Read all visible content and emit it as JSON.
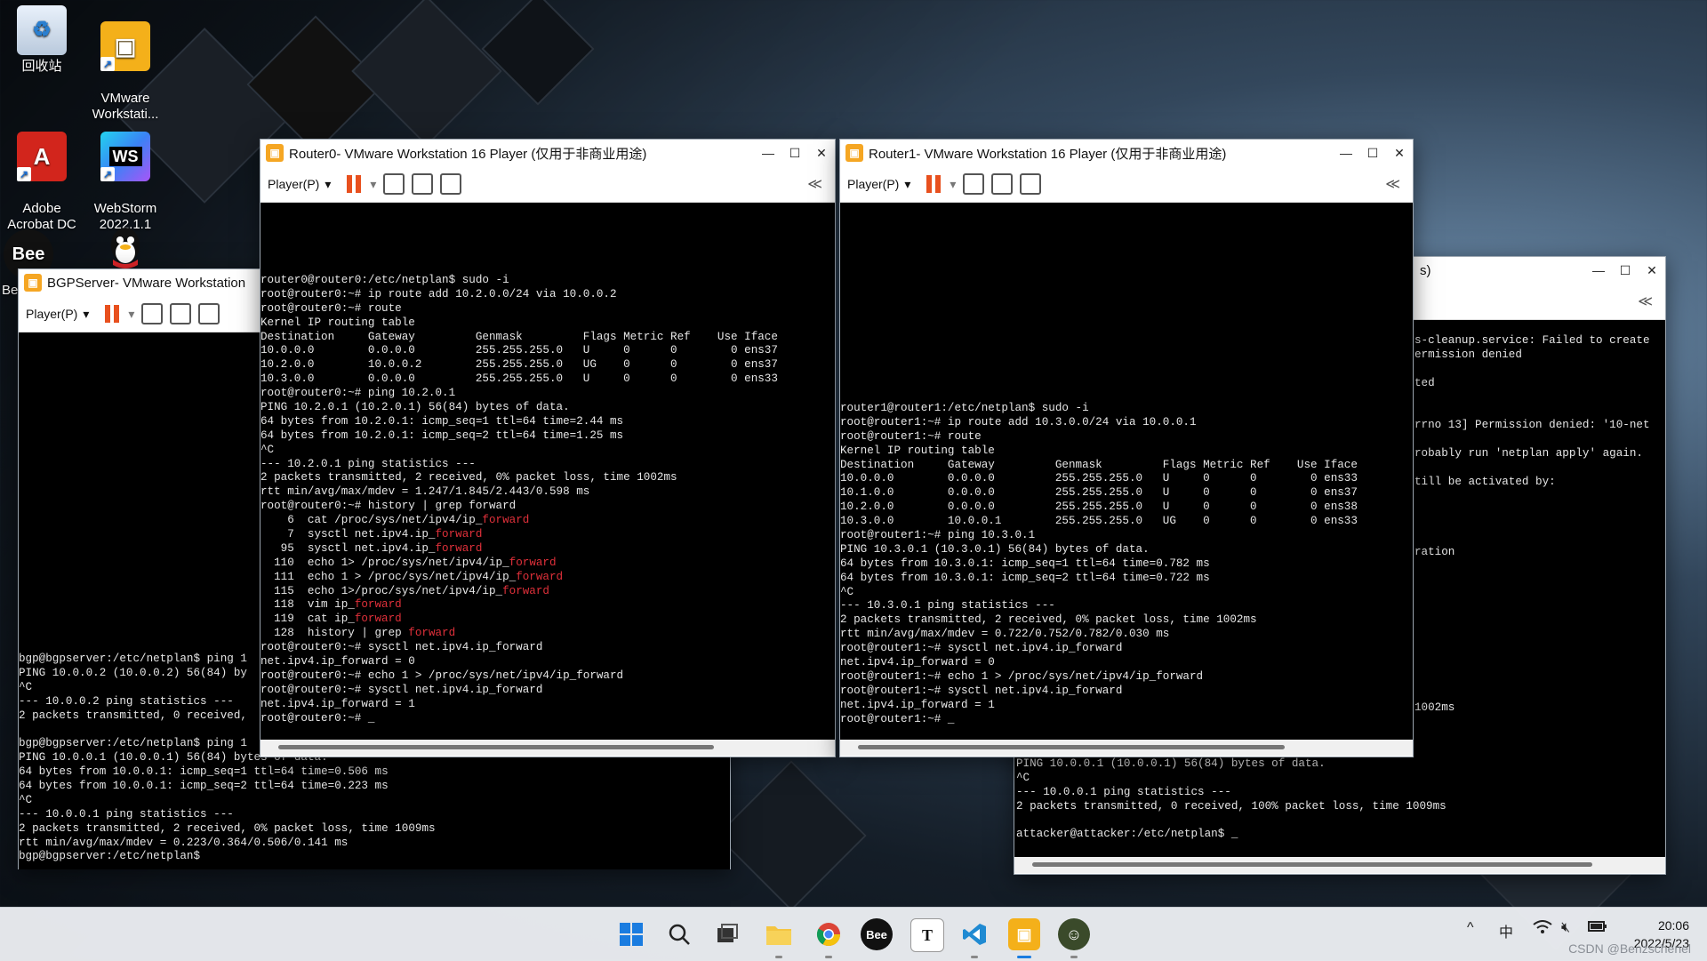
{
  "desktop_icons": [
    {
      "label": "回收站",
      "icon": "recycle-bin-icon"
    },
    {
      "label": "VMware\nWorkstati...",
      "icon": "vmware-icon"
    },
    {
      "label": "Adobe\nAcrobat DC",
      "icon": "acrobat-icon"
    },
    {
      "label": "WebStorm\n2022.1.1",
      "icon": "webstorm-icon"
    },
    {
      "label": "Be",
      "icon": "bee-icon"
    },
    {
      "label": "",
      "icon": "qq-icon"
    }
  ],
  "windows": {
    "bgp": {
      "title": "BGPServer- VMware Workstation",
      "player_label": "Player(P)",
      "lines": [
        "bgp@bgpserver:/etc/netplan$ ping 1",
        "PING 10.0.0.2 (10.0.0.2) 56(84) by",
        "^C",
        "--- 10.0.0.2 ping statistics ---",
        "2 packets transmitted, 0 received,",
        "",
        "bgp@bgpserver:/etc/netplan$ ping 1",
        "PING 10.0.0.1 (10.0.0.1) 56(84) bytes of data.",
        "64 bytes from 10.0.0.1: icmp_seq=1 ttl=64 time=0.506 ms",
        "64 bytes from 10.0.0.1: icmp_seq=2 ttl=64 time=0.223 ms",
        "^C",
        "--- 10.0.0.1 ping statistics ---",
        "2 packets transmitted, 2 received, 0% packet loss, time 1009ms",
        "rtt min/avg/max/mdev = 0.223/0.364/0.506/0.141 ms",
        "bgp@bgpserver:/etc/netplan$"
      ],
      "side_glyph": "In"
    },
    "router0": {
      "title": "Router0- VMware Workstation 16 Player (仅用于非商业用途)",
      "player_label": "Player(P)",
      "lines": [
        "router0@router0:/etc/netplan$ sudo -i",
        "root@router0:~# ip route add 10.2.0.0/24 via 10.0.0.2",
        "root@router0:~# route",
        "Kernel IP routing table",
        "Destination     Gateway         Genmask         Flags Metric Ref    Use Iface",
        "10.0.0.0        0.0.0.0         255.255.255.0   U     0      0        0 ens37",
        "10.2.0.0        10.0.0.2        255.255.255.0   UG    0      0        0 ens37",
        "10.3.0.0        0.0.0.0         255.255.255.0   U     0      0        0 ens33",
        "root@router0:~# ping 10.2.0.1",
        "PING 10.2.0.1 (10.2.0.1) 56(84) bytes of data.",
        "64 bytes from 10.2.0.1: icmp_seq=1 ttl=64 time=2.44 ms",
        "64 bytes from 10.2.0.1: icmp_seq=2 ttl=64 time=1.25 ms",
        "^C",
        "--- 10.2.0.1 ping statistics ---",
        "2 packets transmitted, 2 received, 0% packet loss, time 1002ms",
        "rtt min/avg/max/mdev = 1.247/1.845/2.443/0.598 ms",
        "root@router0:~# history | grep forward",
        "    6  cat /proc/sys/net/ipv4/ip_[forward]",
        "    7  sysctl net.ipv4.ip_[forward]",
        "   95  sysctl net.ipv4.ip_[forward]",
        "  110  echo 1> /proc/sys/net/ipv4/ip_[forward]",
        "  111  echo 1 > /proc/sys/net/ipv4/ip_[forward]",
        "  115  echo 1>/proc/sys/net/ipv4/ip_[forward]",
        "  118  vim ip_[forward]",
        "  119  cat ip_[forward]",
        "  128  history | grep [forward]",
        "root@router0:~# sysctl net.ipv4.ip_forward",
        "net.ipv4.ip_forward = 0",
        "root@router0:~# echo 1 > /proc/sys/net/ipv4/ip_forward",
        "root@router0:~# sysctl net.ipv4.ip_forward",
        "net.ipv4.ip_forward = 1",
        "root@router0:~# _"
      ]
    },
    "router1": {
      "title": "Router1- VMware Workstation 16 Player (仅用于非商业用途)",
      "player_label": "Player(P)",
      "lines": [
        "router1@router1:/etc/netplan$ sudo -i",
        "root@router1:~# ip route add 10.3.0.0/24 via 10.0.0.1",
        "root@router1:~# route",
        "Kernel IP routing table",
        "Destination     Gateway         Genmask         Flags Metric Ref    Use Iface",
        "10.0.0.0        0.0.0.0         255.255.255.0   U     0      0        0 ens33",
        "10.1.0.0        0.0.0.0         255.255.255.0   U     0      0        0 ens37",
        "10.2.0.0        0.0.0.0         255.255.255.0   U     0      0        0 ens38",
        "10.3.0.0        10.0.0.1        255.255.255.0   UG    0      0        0 ens33",
        "root@router1:~# ping 10.3.0.1",
        "PING 10.3.0.1 (10.3.0.1) 56(84) bytes of data.",
        "64 bytes from 10.3.0.1: icmp_seq=1 ttl=64 time=0.782 ms",
        "64 bytes from 10.3.0.1: icmp_seq=2 ttl=64 time=0.722 ms",
        "^C",
        "--- 10.3.0.1 ping statistics ---",
        "2 packets transmitted, 2 received, 0% packet loss, time 1002ms",
        "rtt min/avg/max/mdev = 0.722/0.752/0.782/0.030 ms",
        "root@router1:~# sysctl net.ipv4.ip_forward",
        "net.ipv4.ip_forward = 0",
        "root@router1:~# echo 1 > /proc/sys/net/ipv4/ip_forward",
        "root@router1:~# sysctl net.ipv4.ip_forward",
        "net.ipv4.ip_forward = 1",
        "root@router1:~# _"
      ]
    },
    "attacker": {
      "title_fragment": "s)",
      "top_lines": [
        "s-cleanup.service: Failed to create",
        "ermission denied",
        "",
        "ted",
        "",
        "",
        "rrno 13] Permission denied: '10-net",
        "",
        "robably run 'netplan apply' again.",
        "",
        "till be activated by:",
        "",
        "",
        "",
        "",
        "ration",
        "",
        "",
        "",
        "",
        "",
        "",
        "",
        "",
        "",
        "",
        "1002ms"
      ],
      "bottom_lines": [
        "attacker@attacker:/etc/netplan$ ping 10.0.0.1",
        "PING 10.0.0.1 (10.0.0.1) 56(84) bytes of data.",
        "^C",
        "--- 10.0.0.1 ping statistics ---",
        "2 packets transmitted, 0 received, 100% packet loss, time 1009ms",
        "",
        "attacker@attacker:/etc/netplan$ _"
      ]
    }
  },
  "taskbar": {
    "apps": [
      "windows-start-icon",
      "search-icon",
      "task-view-icon",
      "file-explorer-icon",
      "chrome-icon",
      "bee-icon",
      "typora-icon",
      "vscode-icon",
      "vmware-icon",
      "qq-icon"
    ],
    "tray_chevron": "^",
    "ime": "中",
    "time": "20:06",
    "date": "2022/5/23"
  },
  "watermark": "CSDN @Benzschenel"
}
